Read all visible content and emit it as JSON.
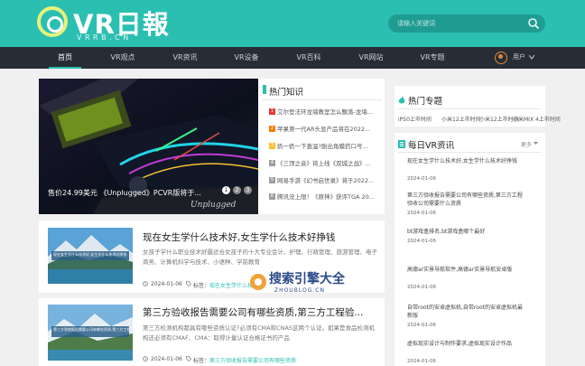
{
  "header": {
    "logo_main": "VR日報",
    "logo_sub": "VRRB.CN",
    "search_placeholder": "请输入关键词"
  },
  "nav": {
    "items": [
      "首页",
      "VR观点",
      "VR资讯",
      "VR设备",
      "VR百科",
      "VR网站",
      "VR专题"
    ],
    "active": "首页",
    "user_label": "用户"
  },
  "hero": {
    "caption": "售价24.99美元 《Unplugged》PCVR版将于...",
    "pages": [
      "1",
      "2",
      "3"
    ]
  },
  "hot_knowledge": {
    "title": "热门知识",
    "items": [
      {
        "num": "1",
        "text": "艾尔登法环龙墙教室怎么飘落-龙墙..."
      },
      {
        "num": "2",
        "text": "苹果第一代AR头显产品将在2022..."
      },
      {
        "num": "3",
        "text": "奶一奶一下查温?胎出角膜药口号..."
      },
      {
        "num": "4",
        "text": "《三顶之音》将上线《双城之战》..."
      },
      {
        "num": "5",
        "text": "网易手游《幻书启世录》将于2022..."
      },
      {
        "num": "6",
        "text": "腾讯没上限！《原神》获评TGA 20..."
      }
    ]
  },
  "articles": [
    {
      "title": "现在女生学什么技术好,女生学什么技术好挣钱",
      "desc": "女孩子学什么职业技术好最适合女孩子的十大专业会计、护理、行政管理、旅游管理、电子商务、计算机科学与技术、小语种、学前教育",
      "date": "2024-01-06",
      "tag_label": "标签：",
      "tag": "现在女生学什么技术好",
      "thumb_caption": "现在女生学什么技术好,女生学什么技术好挣钱"
    },
    {
      "title": "第三方验收报告需要公司有哪些资质,第三方工程验...",
      "desc": "第三方检测机构都具有哪些资质认证?必须有CMA和CNAS这两个认证。如果是食品检测机构还必须有CMAF、CMA：取得计量认证合格证书的产品",
      "date": "2024-01-06",
      "tag_label": "标签：",
      "tag": "第三方验收报告需要公司有哪些资质",
      "thumb_caption": "第三方验收报告需要公司有哪些资质,第三方工程验收报告"
    }
  ],
  "hot_topics": {
    "title": "热门专题",
    "tags": [
      "iPS0上市时间",
      "小米12上市时间",
      "小米12上市时间",
      "小米MIX 4上市时间"
    ]
  },
  "daily_news": {
    "title": "每日VR资讯",
    "more": "更多",
    "items": [
      {
        "title": "现在女生学什么技术好,女生学什么技术好挣钱",
        "date": "2024-01-06"
      },
      {
        "title": "第三方验收报告需要公司有哪些资质,第三方工程验收公司需要什么资质",
        "date": "2024-01-06"
      },
      {
        "title": "bt游戏盒排名,bt游戏盒哪个最好",
        "date": "2024-01-06"
      },
      {
        "title": "高德ar实景导航软件,高德ar实景导航安卓版",
        "date": "2024-01-06"
      },
      {
        "title": "自带root的安卓虚拟机,自带root的安卓虚拟机最新版",
        "date": "2024-01-06"
      },
      {
        "title": "虚拟现实设计与制作要求,虚拟现实设计作品",
        "date": "2024-01-06"
      }
    ]
  },
  "watermark": {
    "text": "搜索引擎大全",
    "sub": "ZHOUBLOG.CN"
  },
  "colors": {
    "brand": "#2bbfb2",
    "nav_bg": "#272d35",
    "hot_1": "#e53935",
    "hot_2": "#f57c00",
    "hot_3": "#fbc02d",
    "hot_rest": "#9e9e9e"
  }
}
